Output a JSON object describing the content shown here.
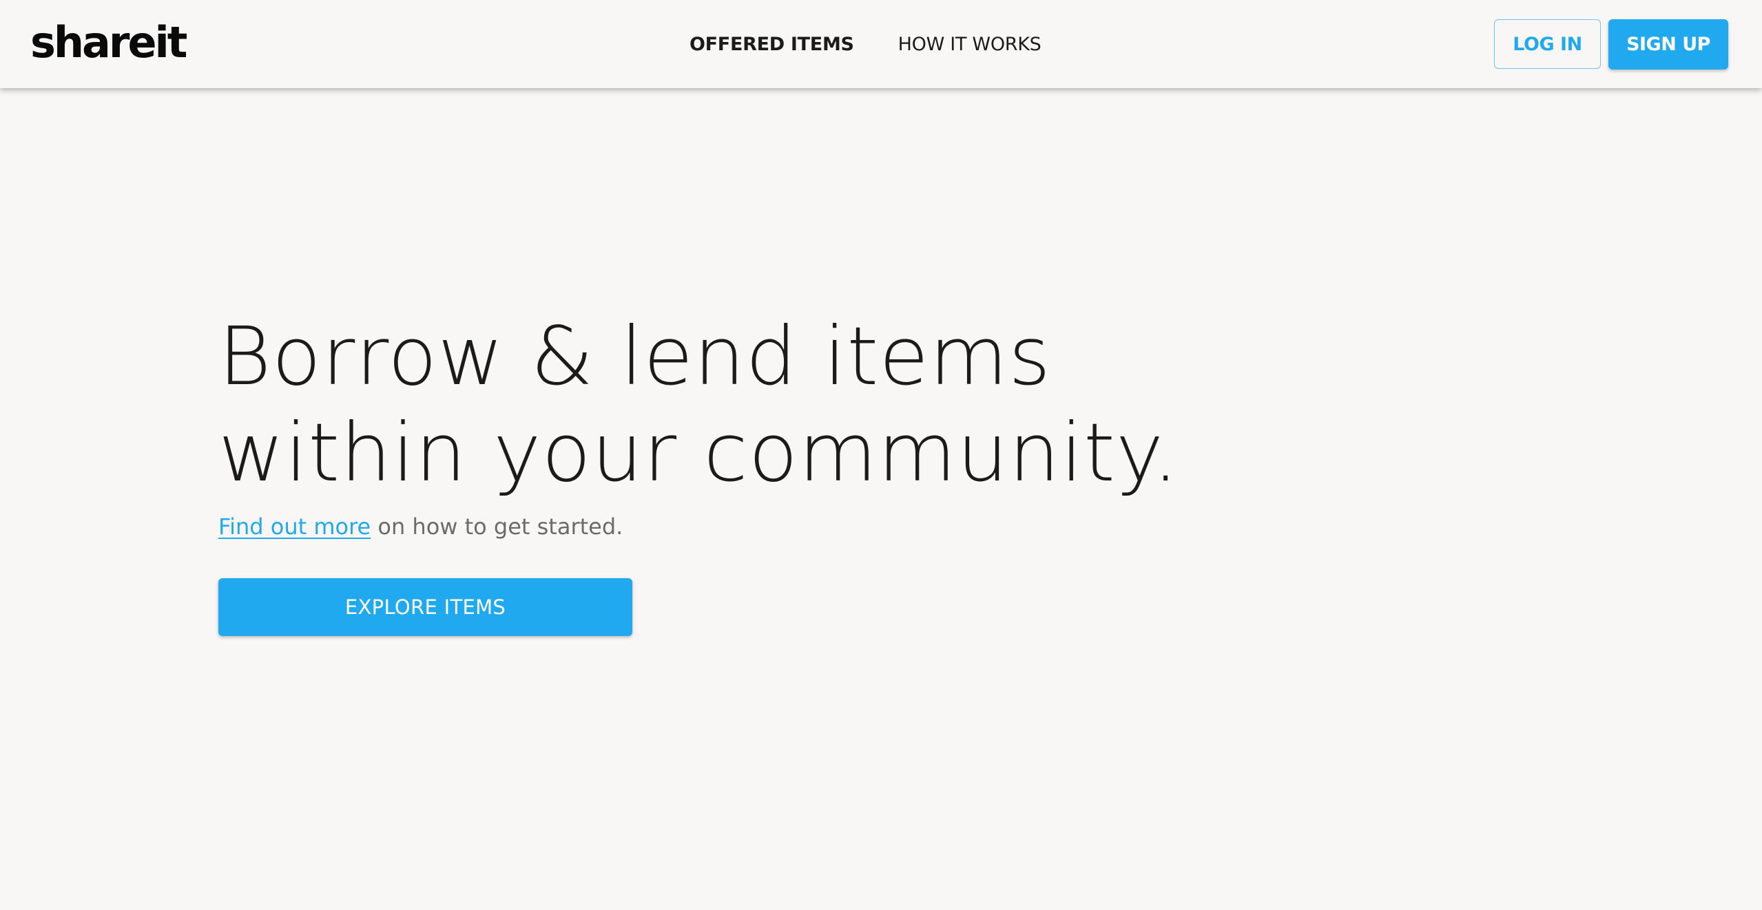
{
  "header": {
    "logo": "shareit",
    "nav": [
      {
        "label": "OFFERED ITEMS",
        "active": true
      },
      {
        "label": "HOW IT WORKS",
        "active": false
      }
    ],
    "login_label": "LOG IN",
    "signup_label": "SIGN UP"
  },
  "hero": {
    "title_line1": "Borrow & lend items",
    "title_line2": "within your community.",
    "subtitle_link": "Find out more",
    "subtitle_rest": " on how to get started.",
    "cta_label": "EXPLORE ITEMS"
  },
  "colors": {
    "accent": "#20a9ef",
    "background": "#f8f7f5",
    "text": "#1b1b1b",
    "muted_text": "#6b6b6b"
  }
}
